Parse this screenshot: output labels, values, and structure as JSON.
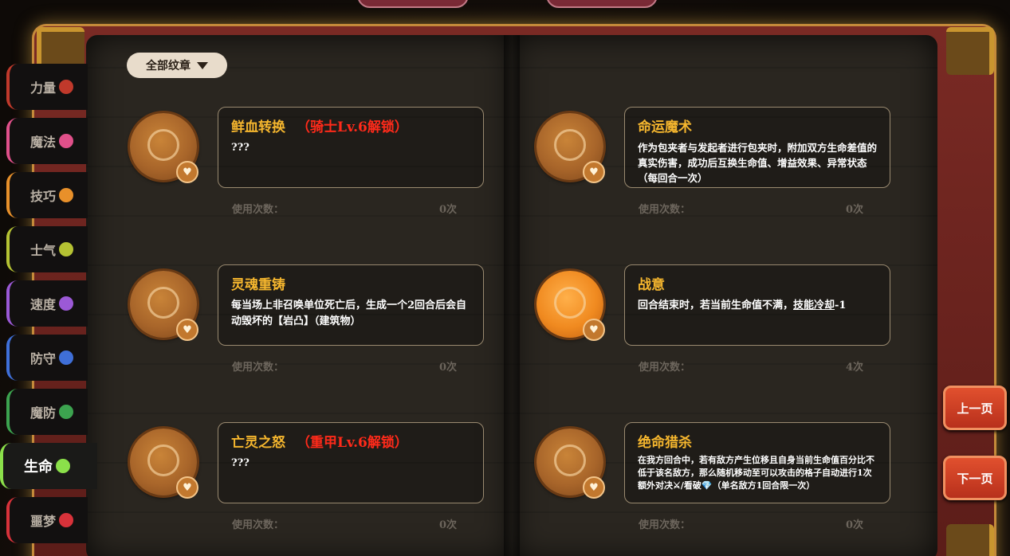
{
  "filter": {
    "label": "全部纹章"
  },
  "sidebar": [
    {
      "label": "力量",
      "color": "#c0392b",
      "icon": "strength-icon"
    },
    {
      "label": "魔法",
      "color": "#e0508a",
      "icon": "magic-icon"
    },
    {
      "label": "技巧",
      "color": "#e8902a",
      "icon": "skill-icon"
    },
    {
      "label": "士气",
      "color": "#b5c233",
      "icon": "morale-icon"
    },
    {
      "label": "速度",
      "color": "#9b59d6",
      "icon": "speed-icon"
    },
    {
      "label": "防守",
      "color": "#3f6fd8",
      "icon": "defense-icon"
    },
    {
      "label": "魔防",
      "color": "#3ca34f",
      "icon": "magic-defense-icon"
    },
    {
      "label": "生命",
      "color": "#8be04a",
      "icon": "life-icon",
      "active": true
    },
    {
      "label": "噩梦",
      "color": "#d8323a",
      "icon": "nightmare-icon"
    }
  ],
  "cards": [
    {
      "title": "鲜血转换",
      "unlock": "（骑士Lv.6解锁）",
      "desc": "???",
      "usage_label": "使用次数：",
      "usage_value": "0次"
    },
    {
      "title": "命运魔术",
      "unlock": "",
      "desc": "作为包夹者与发起者进行包夹时，附加双方生命差值的真实伤害，成功后互换生命值、增益效果、异常状态（每回合一次）",
      "usage_label": "使用次数：",
      "usage_value": "0次"
    },
    {
      "title": "灵魂重铸",
      "unlock": "",
      "desc": "每当场上非召唤单位死亡后，生成一个2回合后会自动毁坏的【岩凸】（建筑物）",
      "usage_label": "使用次数：",
      "usage_value": "0次"
    },
    {
      "title": "战意",
      "unlock": "",
      "desc_a": "回合结束时，若当前生命值不满，",
      "desc_link": "技能冷却",
      "desc_b": "-1",
      "usage_label": "使用次数：",
      "usage_value": "4次"
    },
    {
      "title": "亡灵之怒",
      "unlock": "（重甲Lv.6解锁）",
      "desc": "???",
      "usage_label": "使用次数：",
      "usage_value": "0次"
    },
    {
      "title": "绝命猎杀",
      "unlock": "",
      "desc": "在我方回合中，若有敌方产生位移且自身当前生命值百分比不低于该名敌方，那么随机移动至可以攻击的格子自动进行1次额外对决⚔/看破💎（单名敌方1回合限一次）",
      "usage_label": "使用次数：",
      "usage_value": "0次"
    }
  ],
  "nav": {
    "prev": "上一页",
    "next": "下一页"
  }
}
